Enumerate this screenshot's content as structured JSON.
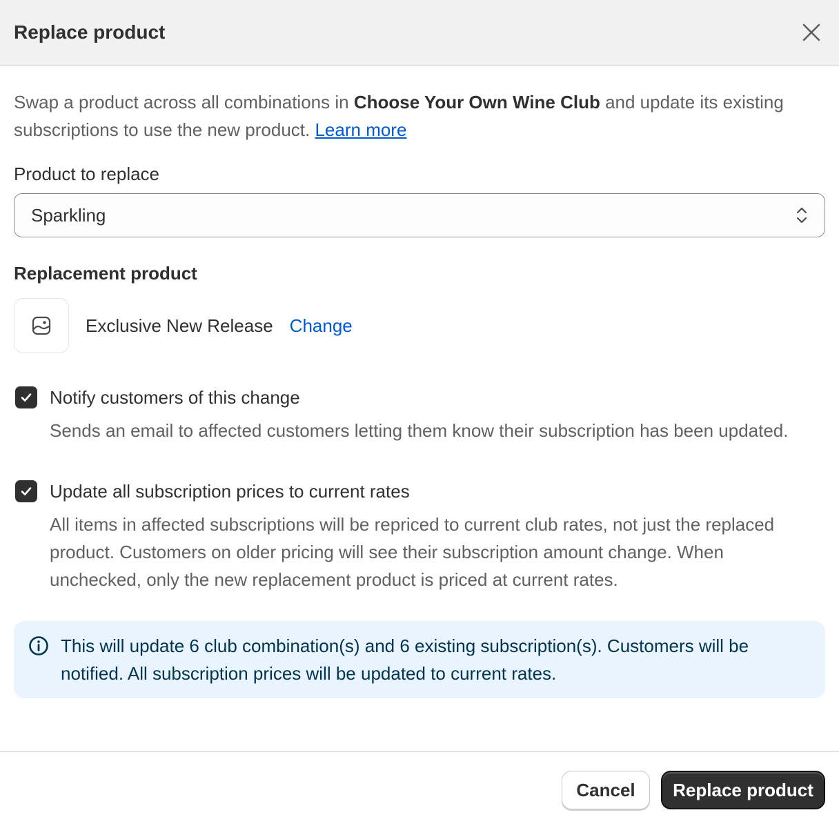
{
  "dialog": {
    "title": "Replace product",
    "close_icon": "close-icon"
  },
  "intro": {
    "prefix": "Swap a product across all combinations in ",
    "club_name": "Choose Your Own Wine Club",
    "suffix": " and update its existing subscriptions to use the new product. ",
    "learn_more": "Learn more"
  },
  "product_to_replace": {
    "label": "Product to replace",
    "selected": "Sparkling",
    "icon": "select-chevrons-icon"
  },
  "replacement": {
    "label": "Replacement product",
    "thumb_icon": "image-placeholder-icon",
    "name": "Exclusive New Release",
    "change_label": "Change"
  },
  "options": [
    {
      "title": "Notify customers of this change",
      "help": "Sends an email to affected customers letting them know their subscription has been updated.",
      "checked": true
    },
    {
      "title": "Update all subscription prices to current rates",
      "help": "All items in affected subscriptions will be repriced to current club rates, not just the replaced product. Customers on older pricing will see their subscription amount change. When unchecked, only the new replacement product is priced at current rates.",
      "checked": true
    }
  ],
  "banner": {
    "icon": "info-icon",
    "text": "This will update 6 club combination(s) and 6 existing subscription(s). Customers will be notified. All subscription prices will be updated to current rates."
  },
  "footer": {
    "cancel_label": "Cancel",
    "confirm_label": "Replace product"
  },
  "colors": {
    "link": "#005bd3",
    "primary": "#303030",
    "banner_bg": "#eaf4ff",
    "banner_text": "#00344f"
  }
}
